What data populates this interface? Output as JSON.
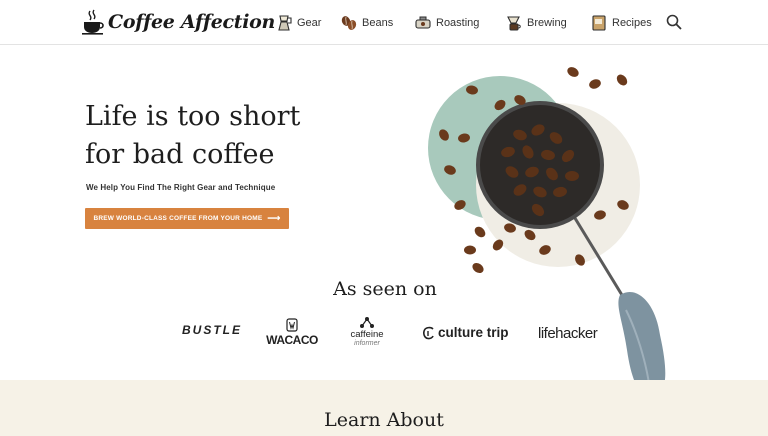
{
  "brand": {
    "name": "Coffee Affection"
  },
  "nav": {
    "items": [
      {
        "label": "Gear",
        "icon": "moka-pot-icon"
      },
      {
        "label": "Beans",
        "icon": "coffee-beans-icon"
      },
      {
        "label": "Roasting",
        "icon": "roaster-icon"
      },
      {
        "label": "Brewing",
        "icon": "brewer-icon"
      },
      {
        "label": "Recipes",
        "icon": "recipe-book-icon"
      }
    ],
    "search_icon": "search-icon"
  },
  "hero": {
    "title_line1": "Life is too short",
    "title_line2": "for bad coffee",
    "subtitle": "We Help You Find The Right Gear and Technique",
    "cta_label": "BREW WORLD-CLASS COFFEE FROM YOUR HOME",
    "cta_arrow": "⟶"
  },
  "seen_on": {
    "title": "As seen on",
    "brands": [
      "BUSTLE",
      "WACACO",
      "caffeine",
      "informer",
      "culture trip",
      "lifehacker"
    ]
  },
  "learn": {
    "title": "Learn About"
  },
  "colors": {
    "accent": "#d8833f",
    "band": "#f6f2e7",
    "mint": "#9fc4b7"
  }
}
